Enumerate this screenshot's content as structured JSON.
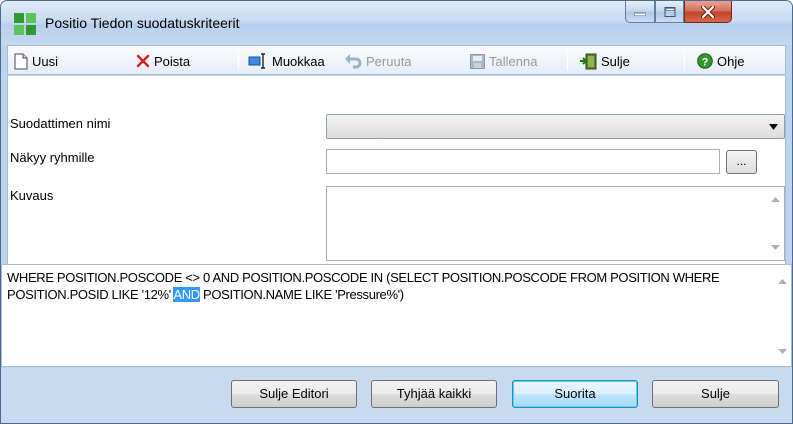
{
  "window": {
    "title": "Positio Tiedon suodatuskriteerit"
  },
  "toolbar": {
    "new_label": "Uusi",
    "delete_label": "Poista",
    "edit_label": "Muokkaa",
    "undo_label": "Peruuta",
    "save_label": "Tallenna",
    "close_label": "Sulje",
    "help_label": "Ohje"
  },
  "form": {
    "filter_name_label": "Suodattimen nimi",
    "filter_name_value": "",
    "visible_groups_label": "Näkyy ryhmille",
    "visible_groups_value": "",
    "ellipsis_label": "...",
    "description_label": "Kuvaus",
    "description_value": ""
  },
  "sql": {
    "before_highlight": "WHERE POSITION.POSCODE <> 0 AND POSITION.POSCODE IN (SELECT POSITION.POSCODE FROM POSITION WHERE POSITION.POSID LIKE '12%' ",
    "highlighted": "AND",
    "after_highlight": " POSITION.NAME LIKE 'Pressure%')"
  },
  "buttons": {
    "close_editor": "Sulje Editori",
    "clear_all": "Tyhjää kaikki",
    "run": "Suorita",
    "close": "Sulje"
  },
  "colors": {
    "selection": "#3399ff",
    "window_frame": "#bcd4ee"
  }
}
